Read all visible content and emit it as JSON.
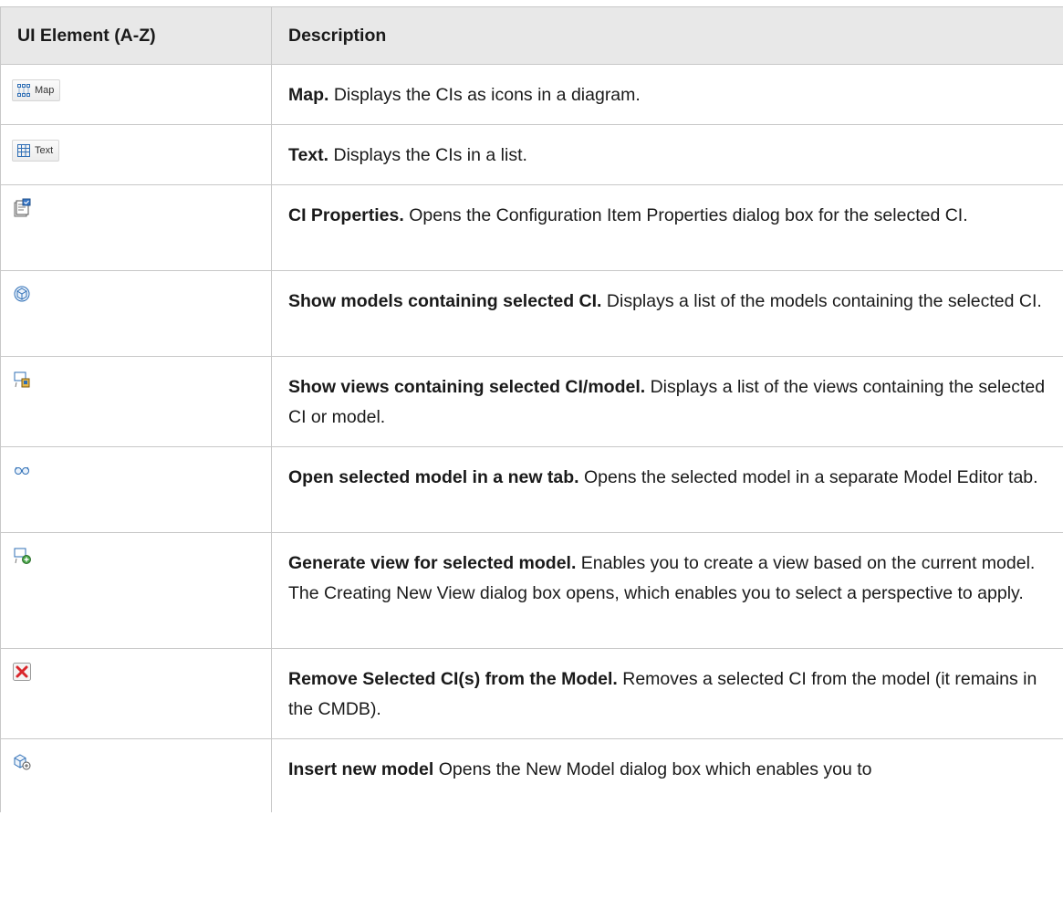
{
  "headers": {
    "element": "UI Element (A-Z)",
    "description": "Description"
  },
  "rows": [
    {
      "icon": "map-icon",
      "button_label": "Map",
      "title": "Map.",
      "text": " Displays the CIs as icons in a diagram."
    },
    {
      "icon": "table-icon",
      "button_label": "Text",
      "title": "Text.",
      "text": " Displays the CIs in a list."
    },
    {
      "icon": "properties-icon",
      "title": "CI Properties.",
      "text": " Opens the Configuration Item Properties dialog box for the selected CI."
    },
    {
      "icon": "model-cube-icon",
      "title": "Show models containing selected CI.",
      "text": " Displays a list of the models containing the selected CI."
    },
    {
      "icon": "views-icon",
      "title": "Show views containing selected CI/model.",
      "text": " Displays a list of the views containing the selected CI or model."
    },
    {
      "icon": "glasses-icon",
      "title": "Open selected model in a new tab.",
      "text": " Opens the selected model in a separate Model Editor tab."
    },
    {
      "icon": "generate-view-icon",
      "title": "Generate view for selected model.",
      "text": " Enables you to create a view based on the current model. The Creating New View dialog box opens, which enables you to select a perspective to apply."
    },
    {
      "icon": "remove-icon",
      "title": "Remove Selected CI(s) from the Model.",
      "text": " Removes a selected CI from the model (it remains in the CMDB)."
    },
    {
      "icon": "insert-model-icon",
      "title": "Insert new model",
      "text": " Opens the New Model dialog box which enables you to"
    }
  ],
  "colors": {
    "header_bg": "#e8e8e8",
    "border": "#c8c8c8",
    "remove_accent": "#d9262b",
    "icon_blue": "#2f6fb6"
  }
}
